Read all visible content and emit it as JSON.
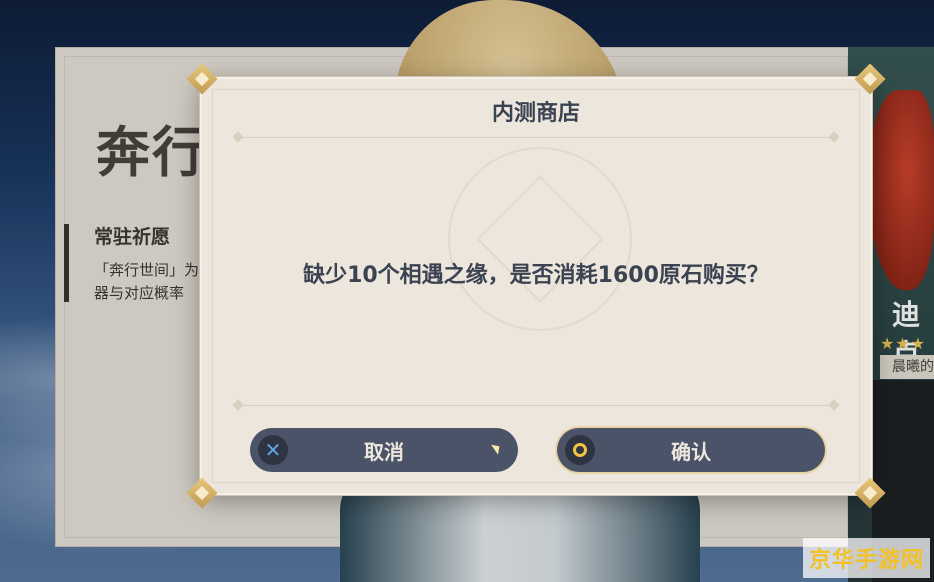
{
  "background": {
    "banner_title": "奔行",
    "banner_subtitle": "常驻祈愿",
    "banner_desc_line1": "「奔行世间」为",
    "banner_desc_line2": "器与对应概率",
    "side_character_name": "迪卢",
    "side_character_stars": "★★★",
    "side_character_tag": "晨曦的"
  },
  "dialog": {
    "title": "内测商店",
    "message": "缺少10个相遇之缘，是否消耗1600原石购买？",
    "cancel_label": "取消",
    "confirm_label": "确认",
    "cancel_icon": "x-circle-icon",
    "confirm_icon": "o-circle-icon"
  },
  "watermark": "京华手游网",
  "colors": {
    "dialog_bg": "#ece6dc",
    "button_bg": "#4b5368",
    "text_dark": "#3b4352",
    "accent_gold": "#e8c87a",
    "watermark": "#f3c126"
  }
}
